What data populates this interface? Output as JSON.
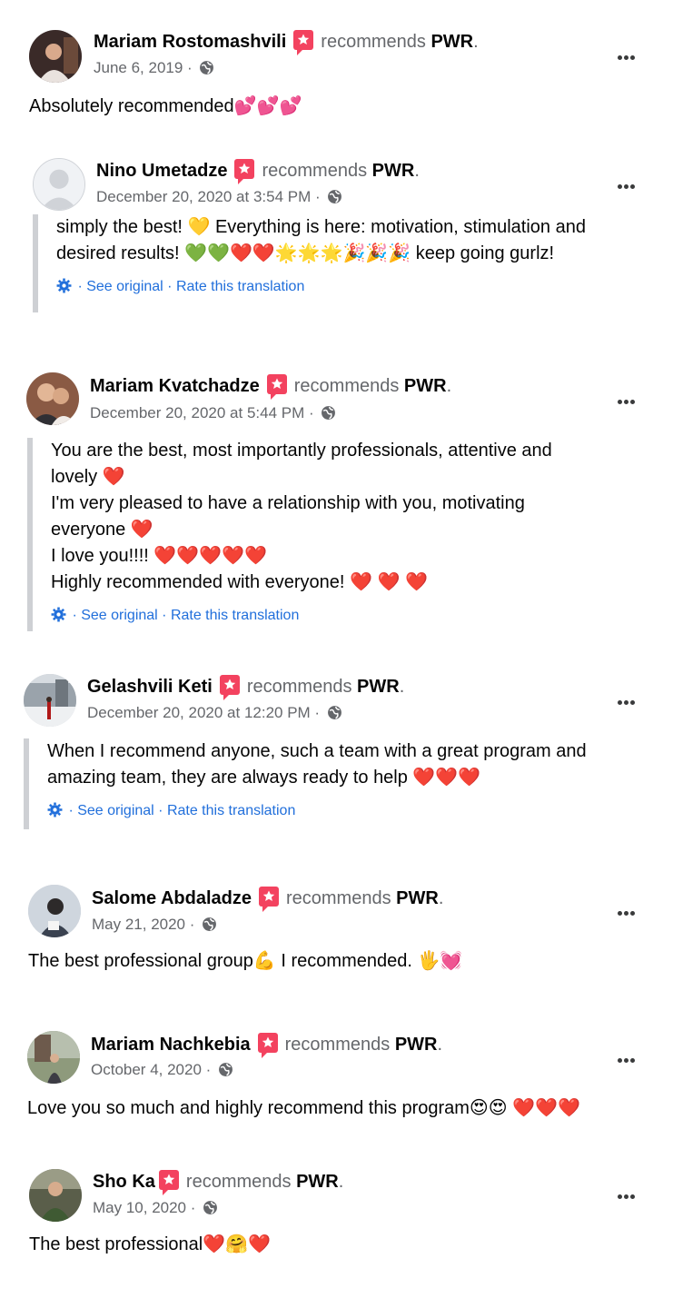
{
  "common": {
    "recommends": "recommends",
    "page": "PWR",
    "period": ".",
    "see_original": "See original",
    "rate_translation": "Rate this translation",
    "sep": " · "
  },
  "colors": {
    "recommend_badge": "#f3425f",
    "link": "#216fdb",
    "meta": "#65676b",
    "quote_bar": "#ced0d4"
  },
  "reviews": [
    {
      "name": "Mariam Rostomashvili",
      "date": "June 6, 2019",
      "text": "Absolutely recommended💕💕💕"
    },
    {
      "name": "Nino Umetadze",
      "date": "December 20, 2020 at 3:54 PM",
      "lines": [
        "simply the best! 💛 Everything is here: motivation, stimulation and",
        "desired results! 💚💚❤️❤️🌟🌟🌟🎉🎉🎉 keep going gurlz!"
      ]
    },
    {
      "name": "Mariam Kvatchadze",
      "date": "December 20, 2020 at 5:44 PM",
      "lines": [
        "You are the best, most importantly professionals, attentive and",
        "lovely ❤️",
        "I'm very pleased to have a relationship with you, motivating",
        "everyone ❤️",
        "I love you!!!! ❤️❤️❤️❤️❤️",
        "Highly recommended with everyone! ❤️ ❤️ ❤️"
      ]
    },
    {
      "name": "Gelashvili Keti",
      "date": "December 20, 2020 at 12:20 PM",
      "lines": [
        "When I recommend anyone, such a team with a great program and",
        "amazing team, they are always ready to help ❤️❤️❤️"
      ]
    },
    {
      "name": "Salome Abdaladze",
      "date": "May 21, 2020",
      "text": "The best professional group💪 I recommended. 🖐💓"
    },
    {
      "name": "Mariam Nachkebia",
      "date": "October 4, 2020",
      "text": "Love you so much and highly recommend this program😍😍 ❤️❤️❤️"
    },
    {
      "name": "Sho Ka",
      "date": "May 10, 2020",
      "text": "The best professional❤️🤗❤️"
    }
  ]
}
